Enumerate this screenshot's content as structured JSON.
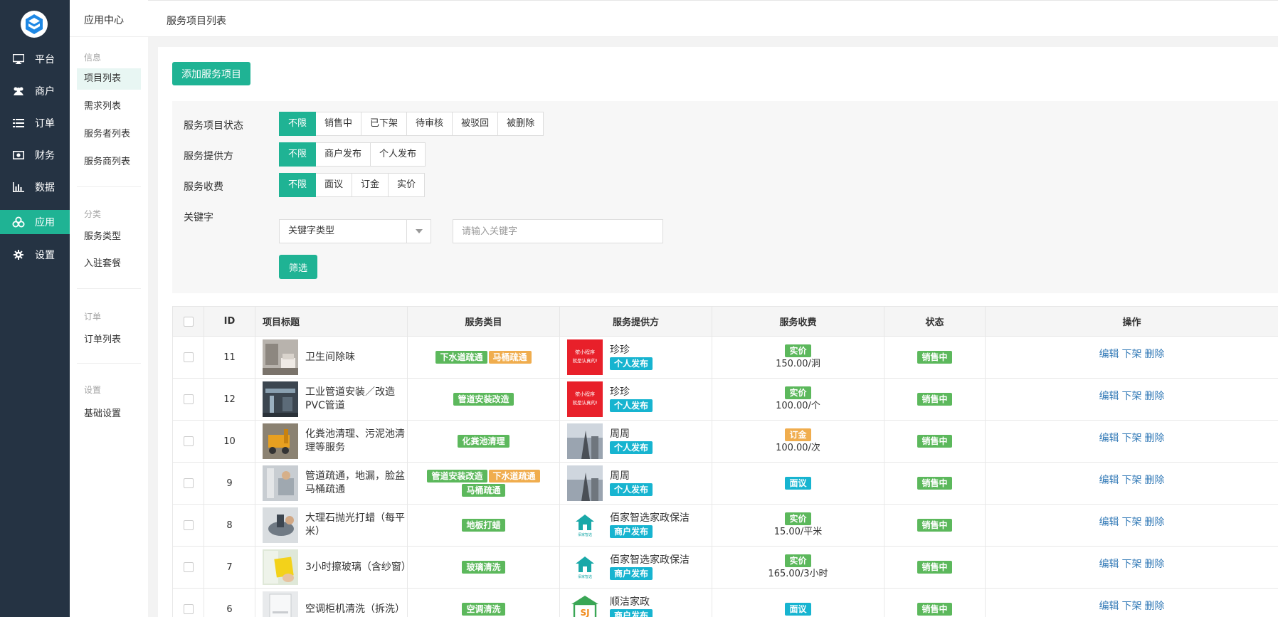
{
  "colors": {
    "accent": "#1fb394",
    "sidebar": "#253343",
    "tag_green": "#5cb85c",
    "tag_orange": "#f0ad4e",
    "tag_cyan": "#17b4d0",
    "link": "#337ab7"
  },
  "main_nav": [
    {
      "label": "平台",
      "icon": "monitor-icon"
    },
    {
      "label": "商户",
      "icon": "users-icon"
    },
    {
      "label": "订单",
      "icon": "list-icon"
    },
    {
      "label": "财务",
      "icon": "money-icon"
    },
    {
      "label": "数据",
      "icon": "bar-chart-icon"
    },
    {
      "label": "应用",
      "icon": "cubes-icon",
      "active": true
    },
    {
      "label": "设置",
      "icon": "gear-icon"
    }
  ],
  "sub_nav": {
    "title": "应用中心",
    "groups": [
      {
        "label": "信息",
        "items": [
          "项目列表",
          "需求列表",
          "服务者列表",
          "服务商列表"
        ]
      },
      {
        "label": "分类",
        "items": [
          "服务类型",
          "入驻套餐"
        ]
      },
      {
        "label": "订单",
        "items": [
          "订单列表"
        ]
      },
      {
        "label": "设置",
        "items": [
          "基础设置"
        ]
      }
    ]
  },
  "breadcrumb": "服务项目列表",
  "add_button": "添加服务项目",
  "filters": {
    "status": {
      "label": "服务项目状态",
      "options": [
        "不限",
        "销售中",
        "已下架",
        "待审核",
        "被驳回",
        "被删除"
      ]
    },
    "provider": {
      "label": "服务提供方",
      "options": [
        "不限",
        "商户发布",
        "个人发布"
      ]
    },
    "fee": {
      "label": "服务收费",
      "options": [
        "不限",
        "面议",
        "订金",
        "实价"
      ]
    },
    "keyword": {
      "label": "关键字",
      "select_value": "关键字类型",
      "placeholder": "请输入关键字"
    },
    "submit": "筛选"
  },
  "table": {
    "headers": {
      "id": "ID",
      "title": "项目标题",
      "category": "服务类目",
      "provider": "服务提供方",
      "fee": "服务收费",
      "status": "状态",
      "ops": "操作"
    },
    "ops": {
      "edit": "编辑",
      "offline": "下架",
      "delete": "删除"
    },
    "rows": [
      {
        "id": "11",
        "title": "卫生间除味",
        "cats": [
          [
            "下水道疏通",
            "green"
          ],
          [
            "马桶疏通",
            "orange"
          ]
        ],
        "prov": "珍珍",
        "prov_type": "个人发布",
        "prov_img": "red",
        "fee_tag": "实价",
        "fee_color": "green",
        "fee_val": "150.00/洞",
        "status": "销售中"
      },
      {
        "id": "12",
        "title": "工业管道安装／改造PVC管道",
        "cats": [
          [
            "管道安装改造",
            "green"
          ]
        ],
        "prov": "珍珍",
        "prov_type": "个人发布",
        "prov_img": "red",
        "fee_tag": "实价",
        "fee_color": "green",
        "fee_val": "100.00/个",
        "status": "销售中"
      },
      {
        "id": "10",
        "title": "化粪池清理、污泥池清理等服务",
        "cats": [
          [
            "化粪池清理",
            "green"
          ]
        ],
        "prov": "周周",
        "prov_type": "个人发布",
        "prov_img": "photo",
        "fee_tag": "订金",
        "fee_color": "orange",
        "fee_val": "100.00/次",
        "status": "销售中"
      },
      {
        "id": "9",
        "title": "管道疏通，地漏，脸盆马桶疏通",
        "cats": [
          [
            "管道安装改造",
            "green"
          ],
          [
            "下水道疏通",
            "orange"
          ],
          [
            "马桶疏通",
            "green"
          ]
        ],
        "prov": "周周",
        "prov_type": "个人发布",
        "prov_img": "photo",
        "fee_tag": "面议",
        "fee_color": "cyan",
        "fee_val": "",
        "status": "销售中"
      },
      {
        "id": "8",
        "title": "大理石抛光打蜡（每平米）",
        "cats": [
          [
            "地板打蜡",
            "green"
          ]
        ],
        "prov": "佰家智选家政保洁",
        "prov_type": "商户发布",
        "prov_img": "logo",
        "fee_tag": "实价",
        "fee_color": "green",
        "fee_val": "15.00/平米",
        "status": "销售中"
      },
      {
        "id": "7",
        "title": "3小时擦玻璃（含纱窗）",
        "cats": [
          [
            "玻璃清洗",
            "green"
          ]
        ],
        "prov": "佰家智选家政保洁",
        "prov_type": "商户发布",
        "prov_img": "logo",
        "fee_tag": "实价",
        "fee_color": "green",
        "fee_val": "165.00/3小时",
        "status": "销售中"
      },
      {
        "id": "6",
        "title": "空调柜机清洗（拆洗）",
        "cats": [
          [
            "空调清洗",
            "green"
          ]
        ],
        "prov": "顺洁家政",
        "prov_type": "商户发布",
        "prov_img": "logo2",
        "fee_tag": "面议",
        "fee_color": "cyan",
        "fee_val": "",
        "status": "销售中"
      }
    ]
  }
}
